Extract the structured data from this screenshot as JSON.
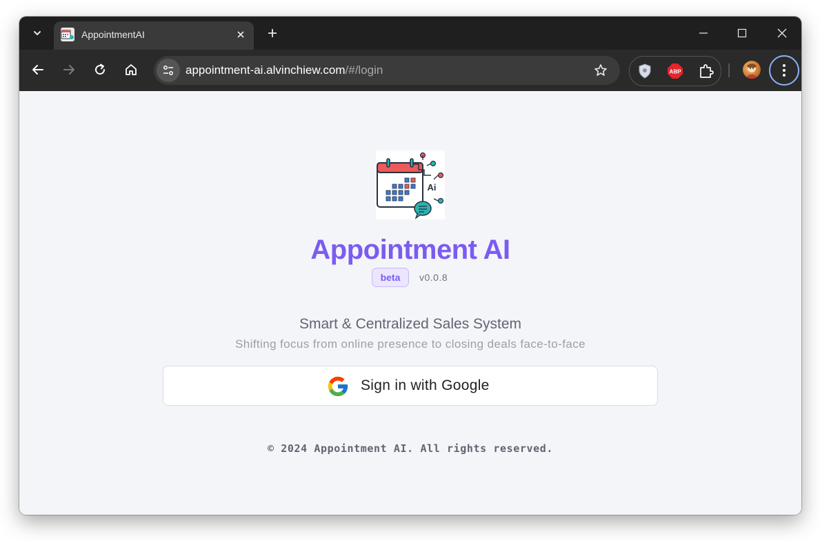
{
  "browser": {
    "tab": {
      "title": "AppointmentAI"
    },
    "address": {
      "host": "appointment-ai.alvinchiew.com",
      "path": "/#/login"
    },
    "extensions": [
      "shield-icon",
      "adblock-plus-icon",
      "extensions-puzzle-icon"
    ]
  },
  "app": {
    "title": "Appointment AI",
    "badge": "beta",
    "version": "v0.0.8",
    "tagline": "Smart & Centralized Sales System",
    "subline": "Shifting focus from online presence to closing deals face-to-face",
    "signin_label": "Sign in with Google",
    "footer": "© 2024 Appointment AI. All rights reserved.",
    "accent_color": "#7b5cf0"
  },
  "colors": {
    "titlebar": "#1f1f1f",
    "toolbar": "#2a2a2a",
    "page_bg": "#f4f5f9",
    "focus_ring": "#8ab4f8"
  }
}
